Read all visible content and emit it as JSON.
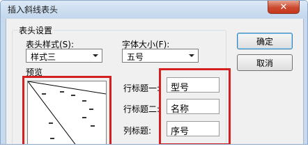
{
  "window": {
    "title": "插入斜线表头",
    "close_glyph": "✕"
  },
  "header_settings": {
    "group_label": "表头设置",
    "style_label": "表头样式(S):",
    "style_value": "样式三",
    "font_size_label": "字体大小(F):",
    "font_size_value": "五号",
    "preview_label": "预览"
  },
  "titles": {
    "row_title_1_label": "行标题一:",
    "row_title_1_value": "型号",
    "row_title_2_label": "行标题二:",
    "row_title_2_value": "名称",
    "col_title_label": "列标题:",
    "col_title_value": "序号"
  },
  "buttons": {
    "ok": "确定",
    "cancel": "取消"
  },
  "colors": {
    "highlight": "#d42020",
    "titlebar": "#c6d9ee",
    "close": "#c7371c"
  }
}
